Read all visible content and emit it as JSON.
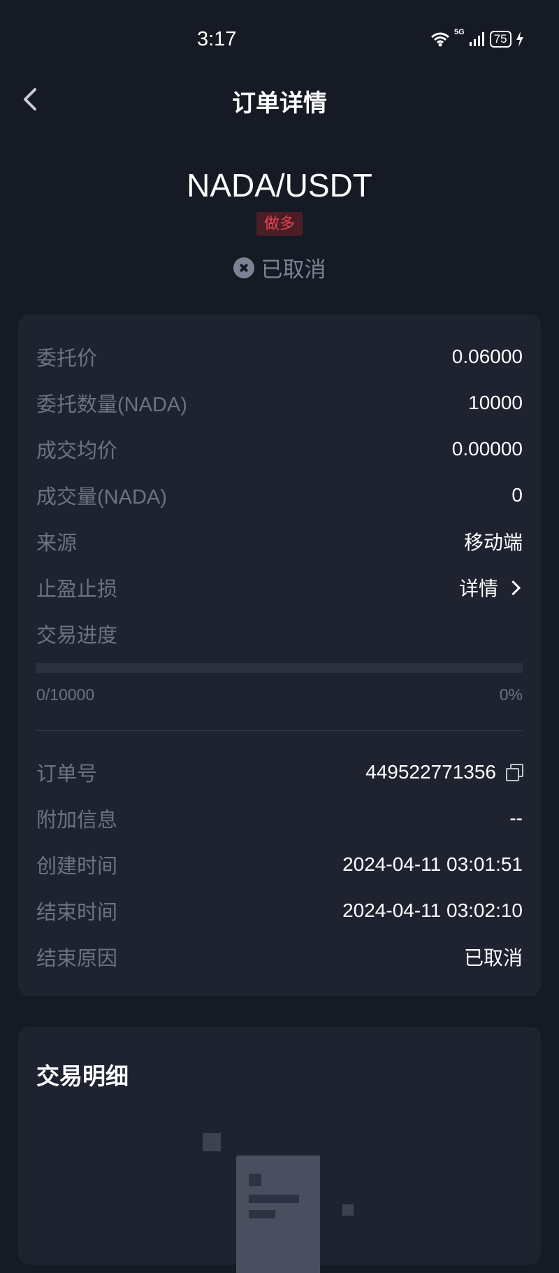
{
  "status_bar": {
    "time": "3:17",
    "network": "5G",
    "battery": "75",
    "icons": [
      "wifi-icon",
      "cellular-signal-icon",
      "battery-icon",
      "charging-icon"
    ]
  },
  "nav": {
    "title": "订单详情",
    "back_icon": "chevron-left-icon"
  },
  "order": {
    "pair": "NADA/USDT",
    "side": "做多",
    "status": "已取消",
    "status_icon": "cancel-circle-icon"
  },
  "details": {
    "order_price": {
      "label": "委托价",
      "value": "0.06000"
    },
    "order_qty": {
      "label": "委托数量(NADA)",
      "value": "10000"
    },
    "avg_price": {
      "label": "成交均价",
      "value": "0.00000"
    },
    "filled_qty": {
      "label": "成交量(NADA)",
      "value": "0"
    },
    "source": {
      "label": "来源",
      "value": "移动端"
    },
    "tp_sl": {
      "label": "止盈止损",
      "value": "详情"
    },
    "progress": {
      "label": "交易进度",
      "filled_text": "0/10000",
      "percent_text": "0%",
      "fraction": 0
    },
    "order_no": {
      "label": "订单号",
      "value": "449522771356"
    },
    "extra_info": {
      "label": "附加信息",
      "value": "--"
    },
    "created_time": {
      "label": "创建时间",
      "value": "2024-04-11 03:01:51"
    },
    "end_time": {
      "label": "结束时间",
      "value": "2024-04-11 03:02:10"
    },
    "end_reason": {
      "label": "结束原因",
      "value": "已取消"
    }
  },
  "trades": {
    "title": "交易明细",
    "empty_icon": "empty-document-icon"
  },
  "colors": {
    "background": "#161a24",
    "card": "#1f2330",
    "label": "#6c7385",
    "long_red": "#e8434f",
    "badge_bg": "#4b1e27"
  }
}
